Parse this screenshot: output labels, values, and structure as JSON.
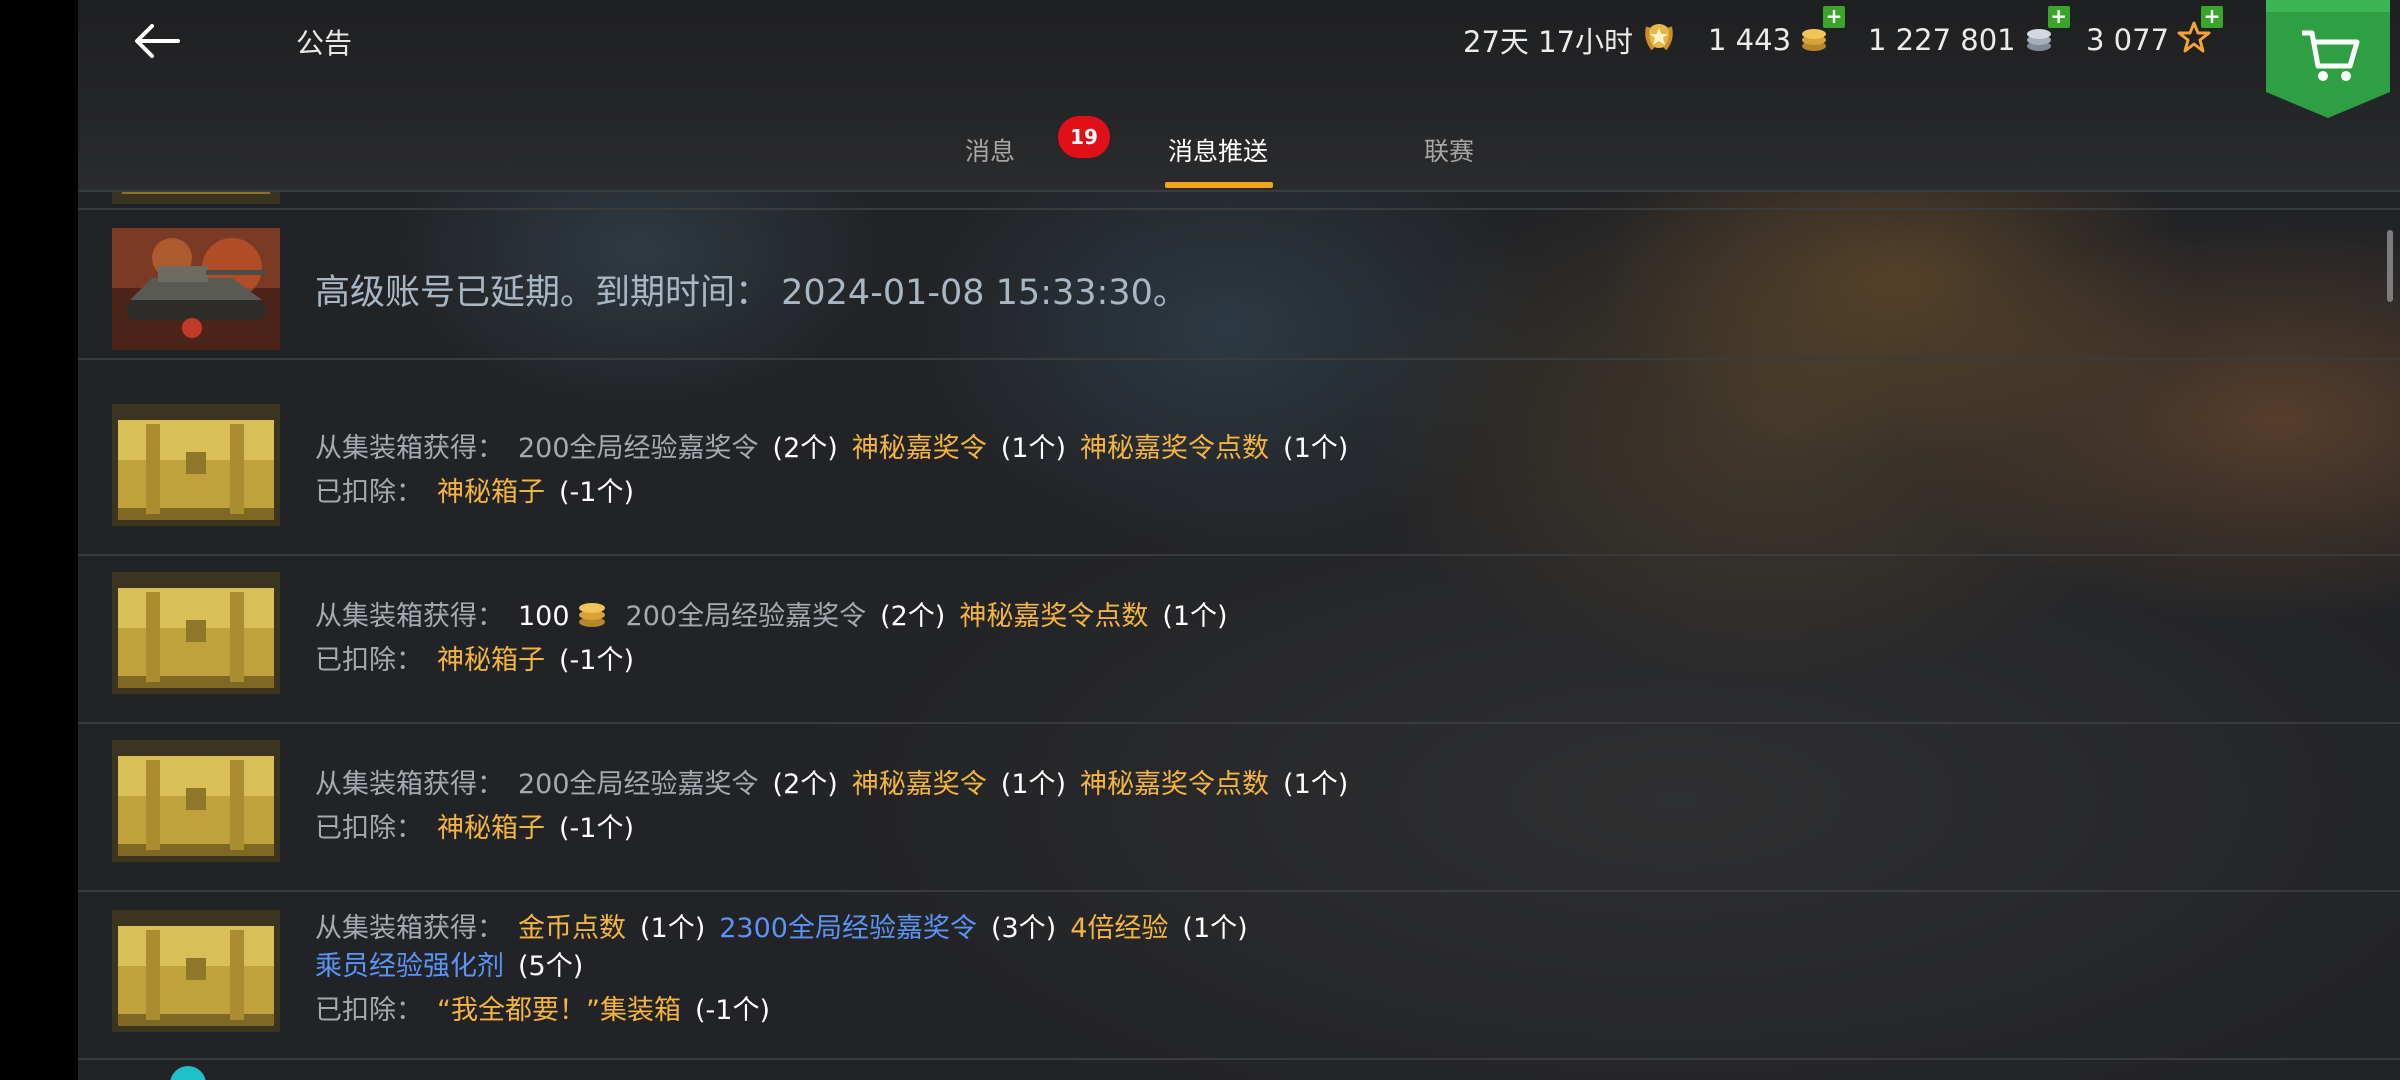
{
  "header": {
    "title": "公告",
    "resources": {
      "premium": "27天 17小时",
      "gold": "1 443",
      "silver": "1 227 801",
      "free_xp": "3 077"
    }
  },
  "tabs": [
    {
      "label": "消息",
      "badge": "19"
    },
    {
      "label": "消息推送",
      "active": true
    },
    {
      "label": "联赛"
    }
  ],
  "messages": [
    {
      "text": "高级账号已延期。到期时间： 2024-01-08 15:33:30。"
    },
    {
      "l1": [
        "从集装箱获得：",
        "200全局经验嘉奖令",
        "(2个)",
        "神秘嘉奖令",
        "(1个)",
        "神秘嘉奖令点数",
        "(1个)"
      ],
      "l2": [
        "已扣除：",
        "神秘箱子",
        "(-1个)"
      ]
    },
    {
      "l1": [
        "从集装箱获得：",
        "100",
        "200全局经验嘉奖令",
        "(2个)",
        "神秘嘉奖令点数",
        "(1个)"
      ],
      "l2": [
        "已扣除：",
        "神秘箱子",
        "(-1个)"
      ]
    },
    {
      "l1": [
        "从集装箱获得：",
        "200全局经验嘉奖令",
        "(2个)",
        "神秘嘉奖令",
        "(1个)",
        "神秘嘉奖令点数",
        "(1个)"
      ],
      "l2": [
        "已扣除：",
        "神秘箱子",
        "(-1个)"
      ]
    },
    {
      "l1": [
        "从集装箱获得：",
        "金币点数",
        "(1个)",
        "2300全局经验嘉奖令",
        "(3个)",
        "4倍经验",
        "(1个)"
      ],
      "l2": [
        "乘员经验强化剂",
        "(5个)"
      ],
      "l3": [
        "已扣除：",
        "“我全都要！”集装箱",
        "(-1个)"
      ]
    }
  ],
  "colors": {
    "accent": "#f5a31b",
    "badge": "#e00f18",
    "shop": "#2ea043",
    "highlight_yellow": "#f3b53f",
    "highlight_blue": "#5b94f5"
  },
  "icons": [
    "back-arrow-icon",
    "premium-laurel-icon",
    "gold-coins-icon",
    "silver-coins-icon",
    "star-icon",
    "plus-icon",
    "shopping-cart-icon",
    "tank-thumbnail",
    "crate-thumbnail"
  ]
}
